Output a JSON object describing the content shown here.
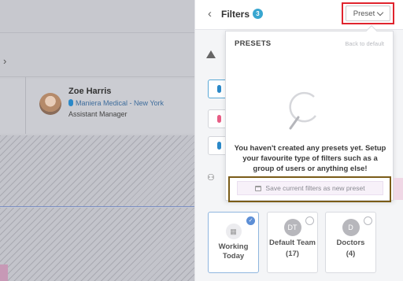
{
  "background_app": {
    "person": {
      "name": "Zoe Harris",
      "organization": "Maniera Medical - New York",
      "role": "Assistant Manager"
    }
  },
  "filters_panel": {
    "title": "Filters",
    "active_count": "3",
    "preset_button_label": "Preset",
    "cards": [
      {
        "label": "Working Today",
        "icon": "calendar-icon",
        "selected": true
      },
      {
        "label": "Default Team",
        "abbr": "DT",
        "count": "(17)",
        "selected": false
      },
      {
        "label": "Doctors",
        "abbr": "D",
        "count": "(4)",
        "selected": false
      }
    ],
    "color_dots": [
      "#2a88c8",
      "#e85d85",
      "#2a88c8"
    ]
  },
  "presets_popup": {
    "title": "PRESETS",
    "back_link": "Back to default",
    "empty_message": "You haven't created any presets yet. Setup your favourite type of filters such as a group of users or anything else!",
    "save_button_label": "Save current filters as new preset"
  },
  "colors": {
    "highlight_preset": "#e0242e",
    "highlight_save": "#7a5c18",
    "accent": "#38a6d0"
  }
}
